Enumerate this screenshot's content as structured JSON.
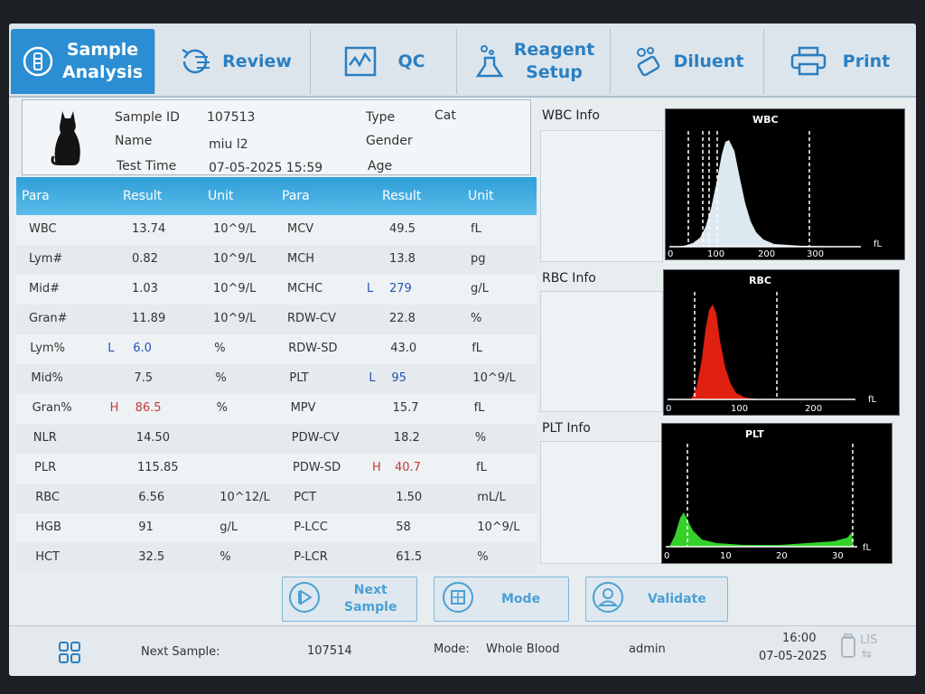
{
  "nav": {
    "tabs": [
      {
        "label1": "Sample",
        "label2": "Analysis",
        "icon": "test-tube-icon"
      },
      {
        "label": "Review",
        "icon": "history-review-icon"
      },
      {
        "label": "QC",
        "icon": "qc-chart-icon"
      },
      {
        "label1": "Reagent",
        "label2": "Setup",
        "icon": "flask-icon"
      },
      {
        "label": "Diluent",
        "icon": "diluent-bubbles-icon"
      },
      {
        "label": "Print",
        "icon": "printer-icon"
      }
    ],
    "active": "Sample Analysis"
  },
  "sample": {
    "id_label": "Sample ID",
    "id": "107513",
    "name_label": "Name",
    "name": "miu l2",
    "time_label": "Test Time",
    "time": "07-05-2025 15:59",
    "type_label": "Type",
    "type": "Cat",
    "gender_label": "Gender",
    "gender": "",
    "age_label": "Age",
    "age": "",
    "animal_icon": "cat-icon"
  },
  "table": {
    "headers": [
      "Para",
      "Result",
      "Unit",
      "Para",
      "Result",
      "Unit"
    ],
    "rows": [
      {
        "p1": "WBC",
        "f1": "",
        "r1": "13.74",
        "u1": "10^9/L",
        "p2": "MCV",
        "f2": "",
        "r2": "49.5",
        "u2": "fL"
      },
      {
        "p1": "Lym#",
        "f1": "",
        "r1": "0.82",
        "u1": "10^9/L",
        "p2": "MCH",
        "f2": "",
        "r2": "13.8",
        "u2": "pg"
      },
      {
        "p1": "Mid#",
        "f1": "",
        "r1": "1.03",
        "u1": "10^9/L",
        "p2": "MCHC",
        "f2": "L",
        "r2": "279",
        "u2": "g/L"
      },
      {
        "p1": "Gran#",
        "f1": "",
        "r1": "11.89",
        "u1": "10^9/L",
        "p2": "RDW-CV",
        "f2": "",
        "r2": "22.8",
        "u2": "%"
      },
      {
        "p1": "Lym%",
        "f1": "L",
        "r1": "6.0",
        "u1": "%",
        "p2": "RDW-SD",
        "f2": "",
        "r2": "43.0",
        "u2": "fL"
      },
      {
        "p1": "Mid%",
        "f1": "",
        "r1": "7.5",
        "u1": "%",
        "p2": "PLT",
        "f2": "L",
        "r2": "95",
        "u2": "10^9/L"
      },
      {
        "p1": "Gran%",
        "f1": "H",
        "r1": "86.5",
        "u1": "%",
        "p2": "MPV",
        "f2": "",
        "r2": "15.7",
        "u2": "fL"
      },
      {
        "p1": "NLR",
        "f1": "",
        "r1": "14.50",
        "u1": "",
        "p2": "PDW-CV",
        "f2": "",
        "r2": "18.2",
        "u2": "%"
      },
      {
        "p1": "PLR",
        "f1": "",
        "r1": "115.85",
        "u1": "",
        "p2": "PDW-SD",
        "f2": "H",
        "r2": "40.7",
        "u2": "fL"
      },
      {
        "p1": "RBC",
        "f1": "",
        "r1": "6.56",
        "u1": "10^12/L",
        "p2": "PCT",
        "f2": "",
        "r2": "1.50",
        "u2": "mL/L"
      },
      {
        "p1": "HGB",
        "f1": "",
        "r1": "91",
        "u1": "g/L",
        "p2": "P-LCC",
        "f2": "",
        "r2": "58",
        "u2": "10^9/L"
      },
      {
        "p1": "HCT",
        "f1": "",
        "r1": "32.5",
        "u1": "%",
        "p2": "P-LCR",
        "f2": "",
        "r2": "61.5",
        "u2": "%"
      }
    ]
  },
  "side": {
    "wbc_info": "WBC Info",
    "rbc_info": "RBC Info",
    "plt_info": "PLT Info"
  },
  "histograms": {
    "wbc": {
      "title": "WBC",
      "unit": "fL",
      "ticks": [
        "0",
        "100",
        "200",
        "300"
      ],
      "fill": "#dde9f0"
    },
    "rbc": {
      "title": "RBC",
      "unit": "fL",
      "ticks": [
        "0",
        "100",
        "200"
      ],
      "fill": "#e02010"
    },
    "plt": {
      "title": "PLT",
      "unit": "fL",
      "ticks": [
        "0",
        "10",
        "20",
        "30"
      ],
      "fill": "#35d02a"
    }
  },
  "buttons": {
    "next1": "Next",
    "next2": "Sample",
    "mode": "Mode",
    "validate": "Validate"
  },
  "status": {
    "next_label": "Next Sample:",
    "next_id": "107514",
    "mode_label": "Mode:",
    "mode_value": "Whole Blood",
    "user": "admin",
    "time": "16:00",
    "date": "07-05-2025",
    "lis": "LIS"
  }
}
